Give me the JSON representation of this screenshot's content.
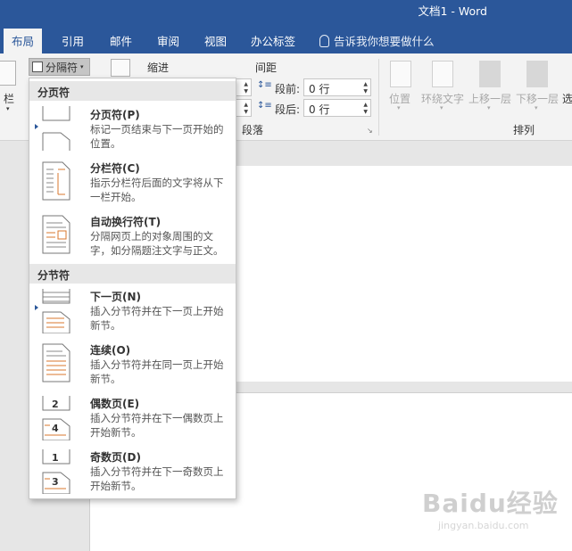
{
  "window": {
    "title": "文档1  -  Word"
  },
  "tabs": [
    {
      "label": "布局",
      "active": true
    },
    {
      "label": "引用"
    },
    {
      "label": "邮件"
    },
    {
      "label": "审阅"
    },
    {
      "label": "视图"
    },
    {
      "label": "办公标签"
    }
  ],
  "tell_me": "告诉我你想要做什么",
  "ribbon": {
    "columns_label": "栏",
    "breaks_label": "分隔符",
    "indent_label": "缩进",
    "spacing_label": "间距",
    "before_label": "段前:",
    "after_label": "段后:",
    "before_value": "0 行",
    "after_value": "0 行",
    "paragraph_group": "段落",
    "position_label": "位置",
    "wrap_label": "环绕文字",
    "forward_label": "上移一层",
    "backward_label": "下移一层",
    "select_label": "选",
    "arrange_group": "排列"
  },
  "menu": {
    "page_breaks_header": "分页符",
    "section_breaks_header": "分节符",
    "items": [
      {
        "title": "分页符(P)",
        "desc": "标记一页结束与下一页开始的位置。"
      },
      {
        "title": "分栏符(C)",
        "desc": "指示分栏符后面的文字将从下一栏开始。"
      },
      {
        "title": "自动换行符(T)",
        "desc": "分隔网页上的对象周围的文字，如分隔题注文字与正文。"
      },
      {
        "title": "下一页(N)",
        "desc": "插入分节符并在下一页上开始新节。"
      },
      {
        "title": "连续(O)",
        "desc": "插入分节符并在同一页上开始新节。"
      },
      {
        "title": "偶数页(E)",
        "desc": "插入分节符并在下一偶数页上开始新节。"
      },
      {
        "title": "奇数页(D)",
        "desc": "插入分节符并在下一奇数页上开始新节。"
      }
    ]
  },
  "watermark": {
    "text": "Baidu经验",
    "url": "jingyan.baidu.com"
  },
  "colors": {
    "brand": "#2b579a",
    "accent_orange": "#d9772d"
  }
}
